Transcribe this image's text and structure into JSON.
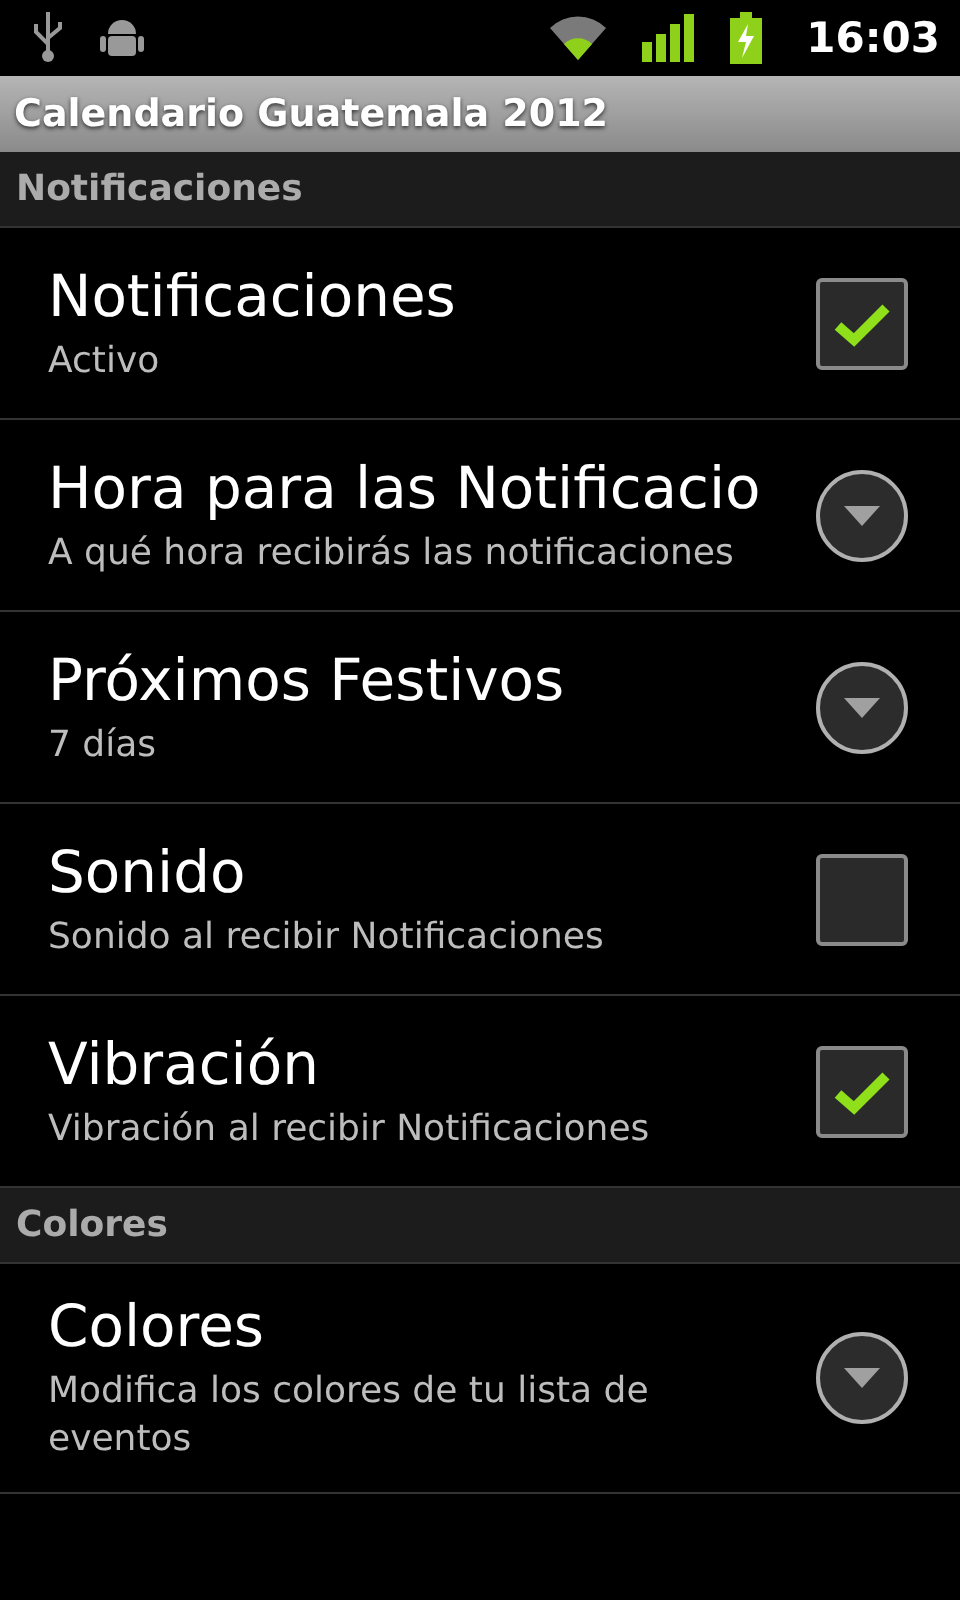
{
  "status_bar": {
    "time": "16:03"
  },
  "title_bar": {
    "title": "Calendario Guatemala 2012"
  },
  "sections": [
    {
      "header": "Notificaciones",
      "items": [
        {
          "kind": "checkbox",
          "title": "Notificaciones",
          "summary": "Activo",
          "checked": true
        },
        {
          "kind": "list",
          "title": "Hora para las Notificacio",
          "summary": "A qué hora recibirás las notificaciones"
        },
        {
          "kind": "list",
          "title": "Próximos Festivos",
          "summary": "7 días"
        },
        {
          "kind": "checkbox",
          "title": "Sonido",
          "summary": "Sonido al recibir Notificaciones",
          "checked": false
        },
        {
          "kind": "checkbox",
          "title": "Vibración",
          "summary": "Vibración al recibir Notificaciones",
          "checked": true
        }
      ]
    },
    {
      "header": "Colores",
      "items": [
        {
          "kind": "list",
          "title": "Colores",
          "summary": "Modifica los colores de tu lista de eventos"
        }
      ]
    }
  ]
}
